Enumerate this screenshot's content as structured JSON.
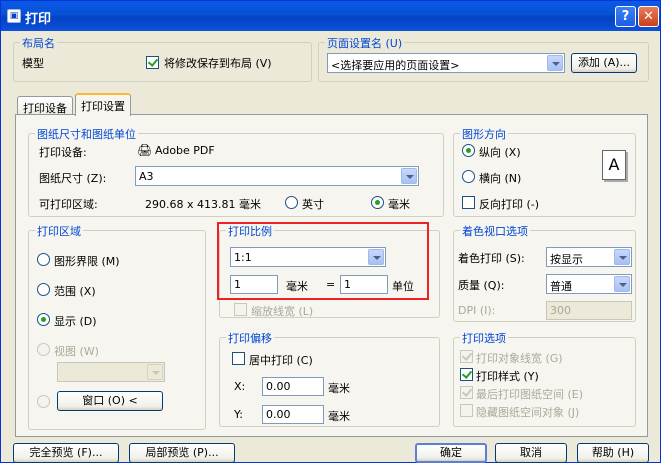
{
  "window": {
    "title": "打印",
    "help": "?",
    "close": "✕"
  },
  "layout_group": {
    "title": "布局名",
    "name": "模型",
    "save_label": "将修改保存到布局 (V)",
    "save_checked": true
  },
  "page_setup": {
    "title": "页面设置名 (U)",
    "selected": "<选择要应用的页面设置>",
    "add_label": "添加 (A)..."
  },
  "tabs": [
    {
      "label": "打印设备",
      "active": false
    },
    {
      "label": "打印设置",
      "active": true
    }
  ],
  "paper": {
    "title": "图纸尺寸和图纸单位",
    "device_label": "打印设备:",
    "device_value": "Adobe PDF",
    "size_label": "图纸尺寸 (Z):",
    "size_value": "A3",
    "area_label": "可打印区域:",
    "area_value": "290.68 x 413.81 毫米",
    "inch_label": "英寸",
    "mm_label": "毫米",
    "units_selected": "mm"
  },
  "orientation": {
    "title": "图形方向",
    "portrait": "纵向 (X)",
    "landscape": "横向 (N)",
    "reverse": "反向打印 (-)",
    "selected": "portrait",
    "preview_letter": "A"
  },
  "plot_area": {
    "title": "打印区域",
    "limits": "图形界限 (M)",
    "extents": "范围 (X)",
    "display": "显示 (D)",
    "view": "视图 (W)",
    "window": "窗口 (O) <",
    "selected": "display"
  },
  "scale": {
    "title": "打印比例",
    "ratio": "1:1",
    "value1": "1",
    "unit1": "毫米",
    "equals": "=",
    "value2": "1",
    "unit2": "单位",
    "lineweights": "缩放线宽 (L)"
  },
  "offset": {
    "title": "打印偏移",
    "center": "居中打印 (C)",
    "x_label": "X:",
    "x_value": "0.00",
    "y_label": "Y:",
    "y_value": "0.00",
    "unit": "毫米"
  },
  "shaded": {
    "title": "着色视口选项",
    "shade_label": "着色打印 (S):",
    "shade_value": "按显示",
    "quality_label": "质量 (Q):",
    "quality_value": "普通",
    "dpi_label": "DPI (I):",
    "dpi_value": "300"
  },
  "options": {
    "title": "打印选项",
    "items": [
      {
        "label": "打印对象线宽 (G)",
        "checked": true,
        "disabled": true
      },
      {
        "label": "打印样式 (Y)",
        "checked": true,
        "disabled": false
      },
      {
        "label": "最后打印图纸空间 (E)",
        "checked": true,
        "disabled": true
      },
      {
        "label": "隐藏图纸空间对象 (J)",
        "checked": false,
        "disabled": true
      }
    ]
  },
  "footer": {
    "full_preview": "完全预览 (F)...",
    "partial_preview": "局部预览 (P)...",
    "ok": "确定",
    "cancel": "取消",
    "help": "帮助 (H)"
  }
}
